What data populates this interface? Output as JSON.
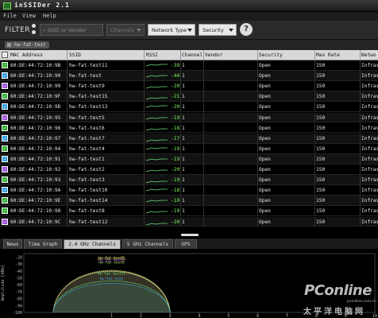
{
  "window": {
    "title": "inSSIDer 2.1"
  },
  "menu": [
    {
      "label": "File"
    },
    {
      "label": "View"
    },
    {
      "label": "Help"
    }
  ],
  "toolbar": {
    "filter_label": "FILTER",
    "ssid_placeholder": "SSID or Vendor",
    "channels_label": "Channels",
    "network_type_label": "Network Type",
    "security_label": "Security",
    "help_label": "?"
  },
  "active_filter": {
    "label": "hw-fat-test"
  },
  "table": {
    "columns": [
      "MAC Address",
      "SSID",
      "RSSI",
      "Channel",
      "Vendor",
      "Security",
      "Max Rate",
      "Netwo"
    ],
    "rows": [
      {
        "check_color": "#2fae2f",
        "mac": "60:DE:44:72:10:9B",
        "ssid": "hw-fat-test11",
        "rssi": "-39",
        "channel": "1",
        "vendor": "",
        "security": "Open",
        "max_rate": "150",
        "network": "Infrast"
      },
      {
        "check_color": "#2f9fdf",
        "mac": "60:DE:44:72:10:90",
        "ssid": "hw-fat-test",
        "rssi": "-44",
        "channel": "1",
        "vendor": "",
        "security": "Open",
        "max_rate": "150",
        "network": "Infrast"
      },
      {
        "check_color": "#a14fd8",
        "mac": "60:DE:44:72:10:99",
        "ssid": "hw-fat-test9",
        "rssi": "-20",
        "channel": "1",
        "vendor": "",
        "security": "Open",
        "max_rate": "150",
        "network": "Infrast"
      },
      {
        "check_color": "#2fae2f",
        "mac": "60:DE:44:72:10:9F",
        "ssid": "hw-fat-test15",
        "rssi": "-21",
        "channel": "1",
        "vendor": "",
        "security": "Open",
        "max_rate": "150",
        "network": "Infrast"
      },
      {
        "check_color": "#2f9fdf",
        "mac": "60:DE:44:72:10:9D",
        "ssid": "hw-fat-test13",
        "rssi": "-20",
        "channel": "1",
        "vendor": "",
        "security": "Open",
        "max_rate": "150",
        "network": "Infrast"
      },
      {
        "check_color": "#a14fd8",
        "mac": "60:DE:44:72:10:95",
        "ssid": "hw-fat-test5",
        "rssi": "-19",
        "channel": "1",
        "vendor": "",
        "security": "Open",
        "max_rate": "150",
        "network": "Infrast"
      },
      {
        "check_color": "#2fae2f",
        "mac": "60:DE:44:72:10:96",
        "ssid": "hw-fat-test6",
        "rssi": "-18",
        "channel": "1",
        "vendor": "",
        "security": "Open",
        "max_rate": "150",
        "network": "Infrast"
      },
      {
        "check_color": "#2f9fdf",
        "mac": "60:DE:44:72:10:97",
        "ssid": "hw-fat-test7",
        "rssi": "-17",
        "channel": "1",
        "vendor": "",
        "security": "Open",
        "max_rate": "150",
        "network": "Infrast"
      },
      {
        "check_color": "#2fae2f",
        "mac": "60:DE:44:72:10:94",
        "ssid": "hw-fat-test4",
        "rssi": "-19",
        "channel": "1",
        "vendor": "",
        "security": "Open",
        "max_rate": "150",
        "network": "Infrast"
      },
      {
        "check_color": "#2f9fdf",
        "mac": "60:DE:44:72:10:91",
        "ssid": "hw-fat-test1",
        "rssi": "-19",
        "channel": "1",
        "vendor": "",
        "security": "Open",
        "max_rate": "150",
        "network": "Infrast"
      },
      {
        "check_color": "#a14fd8",
        "mac": "60:DE:44:72:10:92",
        "ssid": "hw-fat-test2",
        "rssi": "-20",
        "channel": "1",
        "vendor": "",
        "security": "Open",
        "max_rate": "150",
        "network": "Infrast"
      },
      {
        "check_color": "#2fae2f",
        "mac": "60:DE:44:72:10:93",
        "ssid": "hw-fat-test3",
        "rssi": "-19",
        "channel": "1",
        "vendor": "",
        "security": "Open",
        "max_rate": "150",
        "network": "Infrast"
      },
      {
        "check_color": "#2f9fdf",
        "mac": "60:DE:44:72:10:9A",
        "ssid": "hw-fat-test10",
        "rssi": "-18",
        "channel": "1",
        "vendor": "",
        "security": "Open",
        "max_rate": "150",
        "network": "Infrast"
      },
      {
        "check_color": "#2fae2f",
        "mac": "60:DE:44:72:10:9E",
        "ssid": "hw-fat-test14",
        "rssi": "-19",
        "channel": "1",
        "vendor": "",
        "security": "Open",
        "max_rate": "150",
        "network": "Infrast"
      },
      {
        "check_color": "#2fae2f",
        "mac": "60:DE:44:72:10:98",
        "ssid": "hw-fat-test8",
        "rssi": "-19",
        "channel": "1",
        "vendor": "",
        "security": "Open",
        "max_rate": "150",
        "network": "Infrast"
      },
      {
        "check_color": "#a14fd8",
        "mac": "60:DE:44:72:10:9C",
        "ssid": "hw-fat-test12",
        "rssi": "-20",
        "channel": "1",
        "vendor": "",
        "security": "Open",
        "max_rate": "150",
        "network": "Infrast"
      }
    ]
  },
  "tabs": [
    {
      "label": "News"
    },
    {
      "label": "Time Graph"
    },
    {
      "label": "2.4 GHz Channels",
      "active": true
    },
    {
      "label": "5 GHz Channels"
    },
    {
      "label": "GPS"
    }
  ],
  "chart_data": {
    "type": "area",
    "ylabel": "Amplitude [dBm]",
    "xlabel": "",
    "x_ticks": [
      "1",
      "2",
      "3",
      "4",
      "5",
      "6",
      "7",
      "8",
      "9",
      "10"
    ],
    "y_ticks": [
      "-20",
      "-30",
      "-40",
      "-50",
      "-60",
      "-70",
      "-80",
      "-90",
      "-100"
    ],
    "ylim": [
      -100,
      -15
    ],
    "xlim": [
      -2,
      10
    ],
    "grid": false,
    "series": [
      {
        "label": "hw-fat-test5",
        "center": 1,
        "peak": -19,
        "color": "#d8d86a"
      },
      {
        "label": "hw-fat-test2",
        "center": 1,
        "peak": -20,
        "color": "#a14fd8"
      },
      {
        "label": "hw-fat-test9",
        "center": 1,
        "peak": -20,
        "color": "#b7e06a"
      },
      {
        "label": "hw-fat-test15",
        "center": 1,
        "peak": -21,
        "color": "#e0d080"
      },
      {
        "label": "hw-fat-test11",
        "center": 1,
        "peak": -39,
        "color": "#6fe07a"
      },
      {
        "label": "hw-fat-test",
        "center": 1,
        "peak": -44,
        "color": "#3fb0e0"
      }
    ]
  },
  "watermark": {
    "brand": "PConline",
    "site": "太平洋电脑网",
    "domain": "pconline.com.cn"
  }
}
